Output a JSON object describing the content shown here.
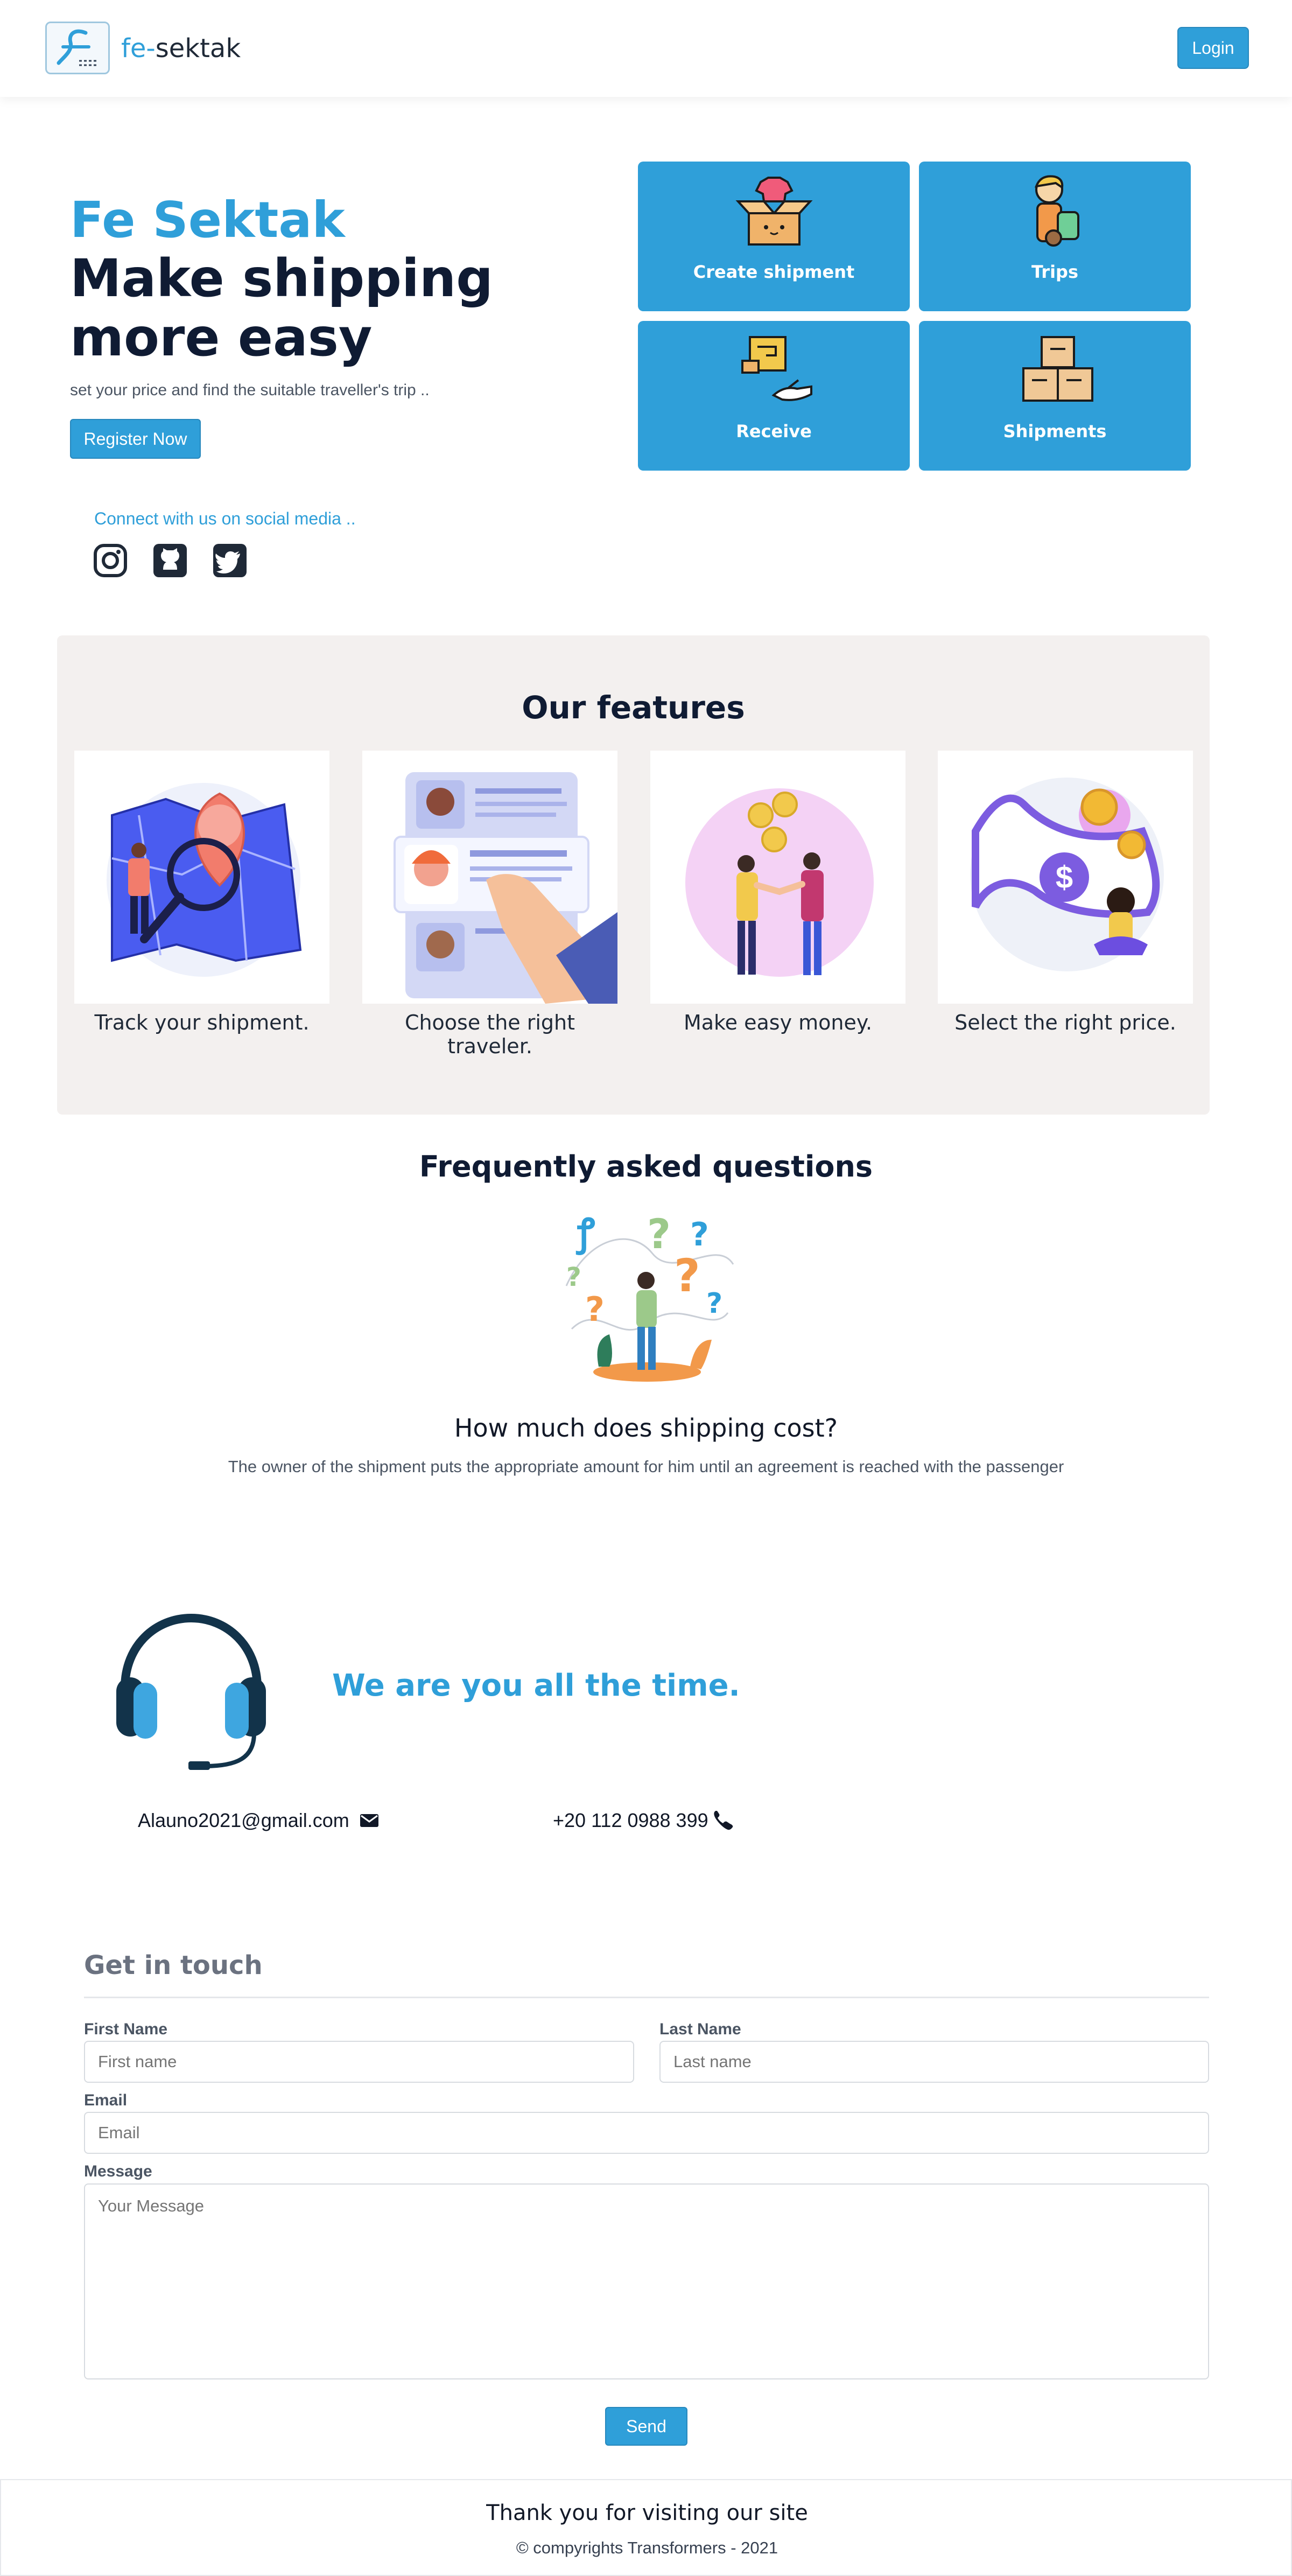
{
  "navbar": {
    "brand_part1": "fe-",
    "brand_part2": "sektak",
    "login_label": "Login"
  },
  "hero": {
    "brand": "Fe Sektak",
    "title": "Make shipping more easy",
    "subtitle": "set your price and find the suitable traveller's trip ..",
    "register_label": "Register Now",
    "tiles": [
      {
        "label": "Create shipment",
        "icon": "open-box-icon"
      },
      {
        "label": "Trips",
        "icon": "traveler-icon"
      },
      {
        "label": "Receive",
        "icon": "package-hand-icon"
      },
      {
        "label": "Shipments",
        "icon": "stacked-boxes-icon"
      }
    ]
  },
  "social": {
    "caption": "Connect with us on social media ..",
    "icons": [
      "instagram-icon",
      "github-icon",
      "twitter-icon"
    ]
  },
  "features": {
    "title": "Our features",
    "items": [
      {
        "caption": "Track your shipment.",
        "illustration": "map-magnifier-illustration"
      },
      {
        "caption": "Choose the right traveler.",
        "illustration": "profile-selection-illustration"
      },
      {
        "caption": "Make easy money.",
        "illustration": "handshake-coins-illustration"
      },
      {
        "caption": "Select the right price.",
        "illustration": "dollar-bill-illustration"
      }
    ]
  },
  "faq": {
    "title": "Frequently asked questions",
    "question": "How much does shipping cost?",
    "answer": "The owner of the shipment puts the appropriate amount for him until an agreement is reached with the passenger"
  },
  "support": {
    "title": "We are you all the time.",
    "email": "Alauno2021@gmail.com",
    "phone": "+20 112 0988 399"
  },
  "contact": {
    "title": "Get in touch",
    "first_name_label": "First Name",
    "first_name_placeholder": "First name",
    "last_name_label": "Last Name",
    "last_name_placeholder": "Last name",
    "email_label": "Email",
    "email_placeholder": "Email",
    "message_label": "Message",
    "message_placeholder": "Your Message",
    "send_label": "Send"
  },
  "footer": {
    "thanks": "Thank you for visiting our site",
    "copyright": "© compyrights Transformers - 2021"
  },
  "colors": {
    "accent": "#2f9fd9",
    "heading": "#0f1b33",
    "features_bg": "#f3f0ef"
  }
}
